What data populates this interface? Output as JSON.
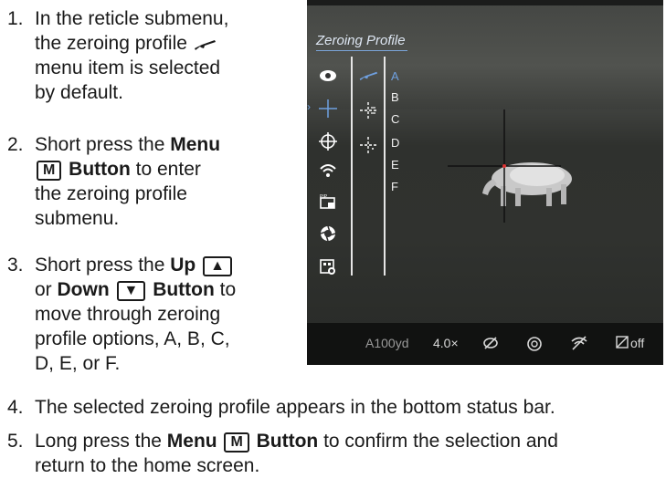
{
  "steps": [
    {
      "num": "1.",
      "line1_a": "In the reticle submenu,",
      "line2_a": "the zeroing profile",
      "line3": "menu item is selected",
      "line4": "by default."
    },
    {
      "num": "2.",
      "line1_a": "Short press the ",
      "line1_b": "Menu",
      "key": "M",
      "line2_b": " Button",
      "line2_c": " to enter",
      "line3": "the zeroing profile",
      "line4": "submenu."
    },
    {
      "num": "3.",
      "line1_a": "Short press the ",
      "line1_b": "Up",
      "line2_a": "or ",
      "line2_b": "Down",
      "line2_c": " Button",
      "line2_d": " to",
      "line3": "move through zeroing",
      "line4": "profile options, A, B, C,",
      "line5": "D, E, or F."
    },
    {
      "num": "4.",
      "text": "The selected zeroing profile appears in the bottom status bar."
    },
    {
      "num": "5.",
      "line1_a": "Long press the ",
      "line1_b": "Menu",
      "key": "M",
      "line1_c": " Button",
      "line1_d": " to confirm the selection and",
      "line2": "return to the home screen."
    }
  ],
  "screen": {
    "title": "Zeroing Profile",
    "profiles": [
      "A",
      "B",
      "C",
      "D",
      "E",
      "F"
    ],
    "selected_profile": "A",
    "status": {
      "profile": "A100yd",
      "zoom": "4.0×",
      "rec": "off"
    },
    "accent_color": "#6fa0e0"
  }
}
